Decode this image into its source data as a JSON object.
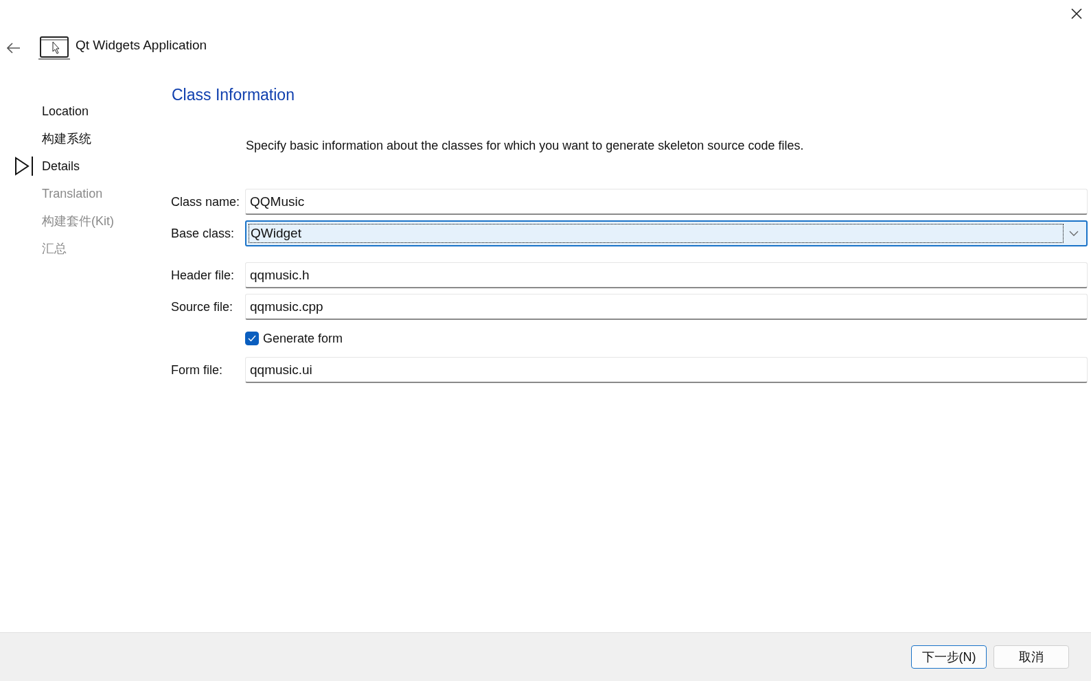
{
  "window": {
    "title": "Qt Widgets Application"
  },
  "steps": [
    {
      "label": "Location",
      "selected": false,
      "disabled": false
    },
    {
      "label": "构建系统",
      "selected": false,
      "disabled": false
    },
    {
      "label": "Details",
      "selected": true,
      "disabled": false
    },
    {
      "label": "Translation",
      "selected": false,
      "disabled": true
    },
    {
      "label": "构建套件(Kit)",
      "selected": false,
      "disabled": true
    },
    {
      "label": "汇总",
      "selected": false,
      "disabled": true
    }
  ],
  "page": {
    "title": "Class Information",
    "description": "Specify basic information about the classes for which you want to generate skeleton source code files."
  },
  "fields": [
    {
      "kind": "text",
      "label": "Class name:",
      "value": "QQMusic"
    },
    {
      "kind": "combo",
      "label": "Base class:",
      "value": "QWidget"
    },
    {
      "kind": "gap"
    },
    {
      "kind": "text",
      "label": "Header file:",
      "value": "qqmusic.h"
    },
    {
      "kind": "text",
      "label": "Source file:",
      "value": "qqmusic.cpp"
    },
    {
      "kind": "checkbox",
      "label": "Generate form",
      "checked": true
    },
    {
      "kind": "text",
      "label": "Form file:",
      "value": "qqmusic.ui"
    }
  ],
  "buttons": [
    {
      "label": "下一步(N)",
      "selected": true
    },
    {
      "label": "取消",
      "selected": false
    }
  ]
}
